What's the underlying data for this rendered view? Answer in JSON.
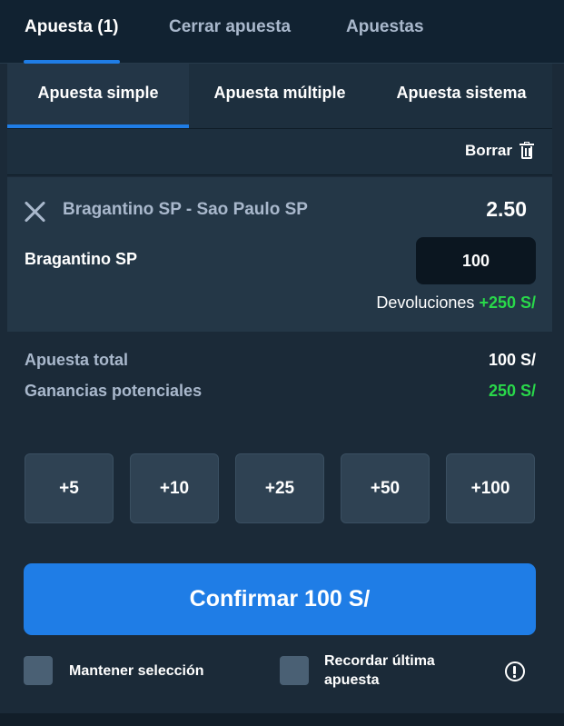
{
  "top_tabs": [
    {
      "label": "Apuesta (1)",
      "active": true
    },
    {
      "label": "Cerrar apuesta",
      "active": false
    },
    {
      "label": "Apuestas",
      "active": false
    }
  ],
  "sub_tabs": [
    {
      "label": "Apuesta simple",
      "active": true
    },
    {
      "label": "Apuesta múltiple",
      "active": false
    },
    {
      "label": "Apuesta sistema",
      "active": false
    }
  ],
  "clear": {
    "label": "Borrar",
    "icon": "trash-icon"
  },
  "bet": {
    "match": "Bragantino SP - Sao Paulo SP",
    "odds": "2.50",
    "selection": "Bragantino SP",
    "stake": "100",
    "returns_label": "Devoluciones",
    "returns_value": "+250 S/"
  },
  "summary": {
    "total_label": "Apuesta total",
    "total_value": "100 S/",
    "potential_label": "Ganancias potenciales",
    "potential_value": "250 S/"
  },
  "quick_stakes": [
    "+5",
    "+10",
    "+25",
    "+50",
    "+100"
  ],
  "confirm_label": "Confirmar 100 S/",
  "options": {
    "keep_selection": "Mantener selección",
    "remember_last_line1": "Recordar última",
    "remember_last_line2": "apuesta"
  },
  "colors": {
    "accent": "#1f7de6",
    "positive": "#29d84a",
    "background": "#1b2a38"
  }
}
